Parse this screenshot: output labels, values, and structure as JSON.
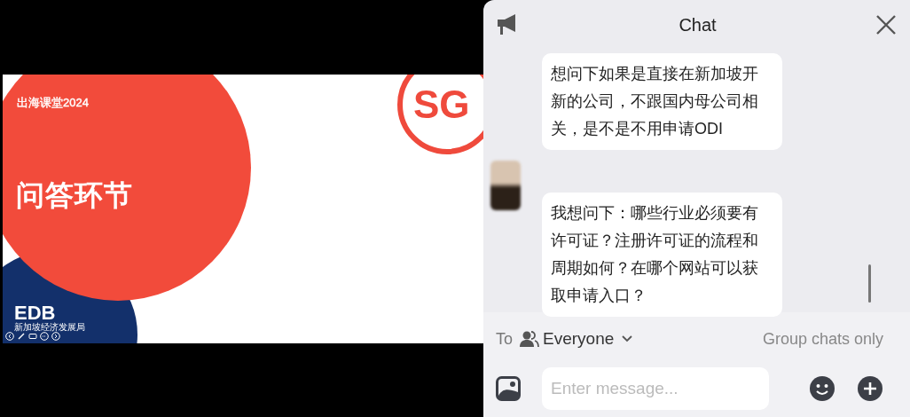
{
  "slide": {
    "series_label": "出海课堂2024",
    "title": "问答环节",
    "logo_text": "SG",
    "footer_logo": "EDB",
    "footer_caption": "新加坡经济发展局"
  },
  "chat": {
    "title": "Chat",
    "messages": [
      {
        "text": "想问下如果是直接在新加坡开新的公司，不跟国内母公司相关，是不是不用申请ODI",
        "avatar": false
      },
      {
        "text": "我想问下：哪些行业必须要有许可证？注册许可证的流程和周期如何？在哪个网站可以获取申请入口？",
        "avatar": true
      }
    ],
    "recipient_prefix": "To",
    "recipient": "Everyone",
    "mode": "Group chats only",
    "input": {
      "placeholder": "Enter message..."
    }
  }
}
